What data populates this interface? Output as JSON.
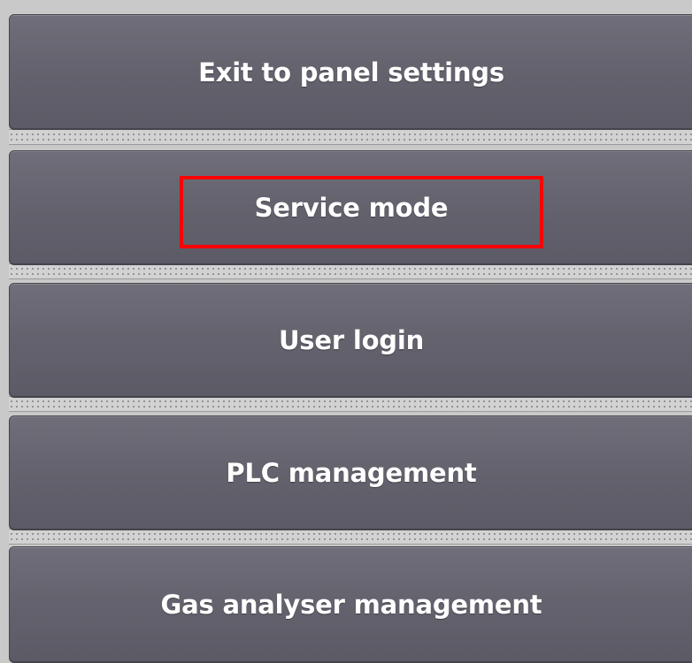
{
  "menu": {
    "items": [
      {
        "label": "Exit to panel settings"
      },
      {
        "label": "Service mode"
      },
      {
        "label": "User login"
      },
      {
        "label": "PLC management"
      },
      {
        "label": "Gas analyser management"
      }
    ],
    "highlighted_item": "Service mode"
  },
  "colors": {
    "button_face": "#64636e",
    "button_text": "#ffffff",
    "background": "#c9c9c9",
    "highlight": "#ff0000"
  }
}
